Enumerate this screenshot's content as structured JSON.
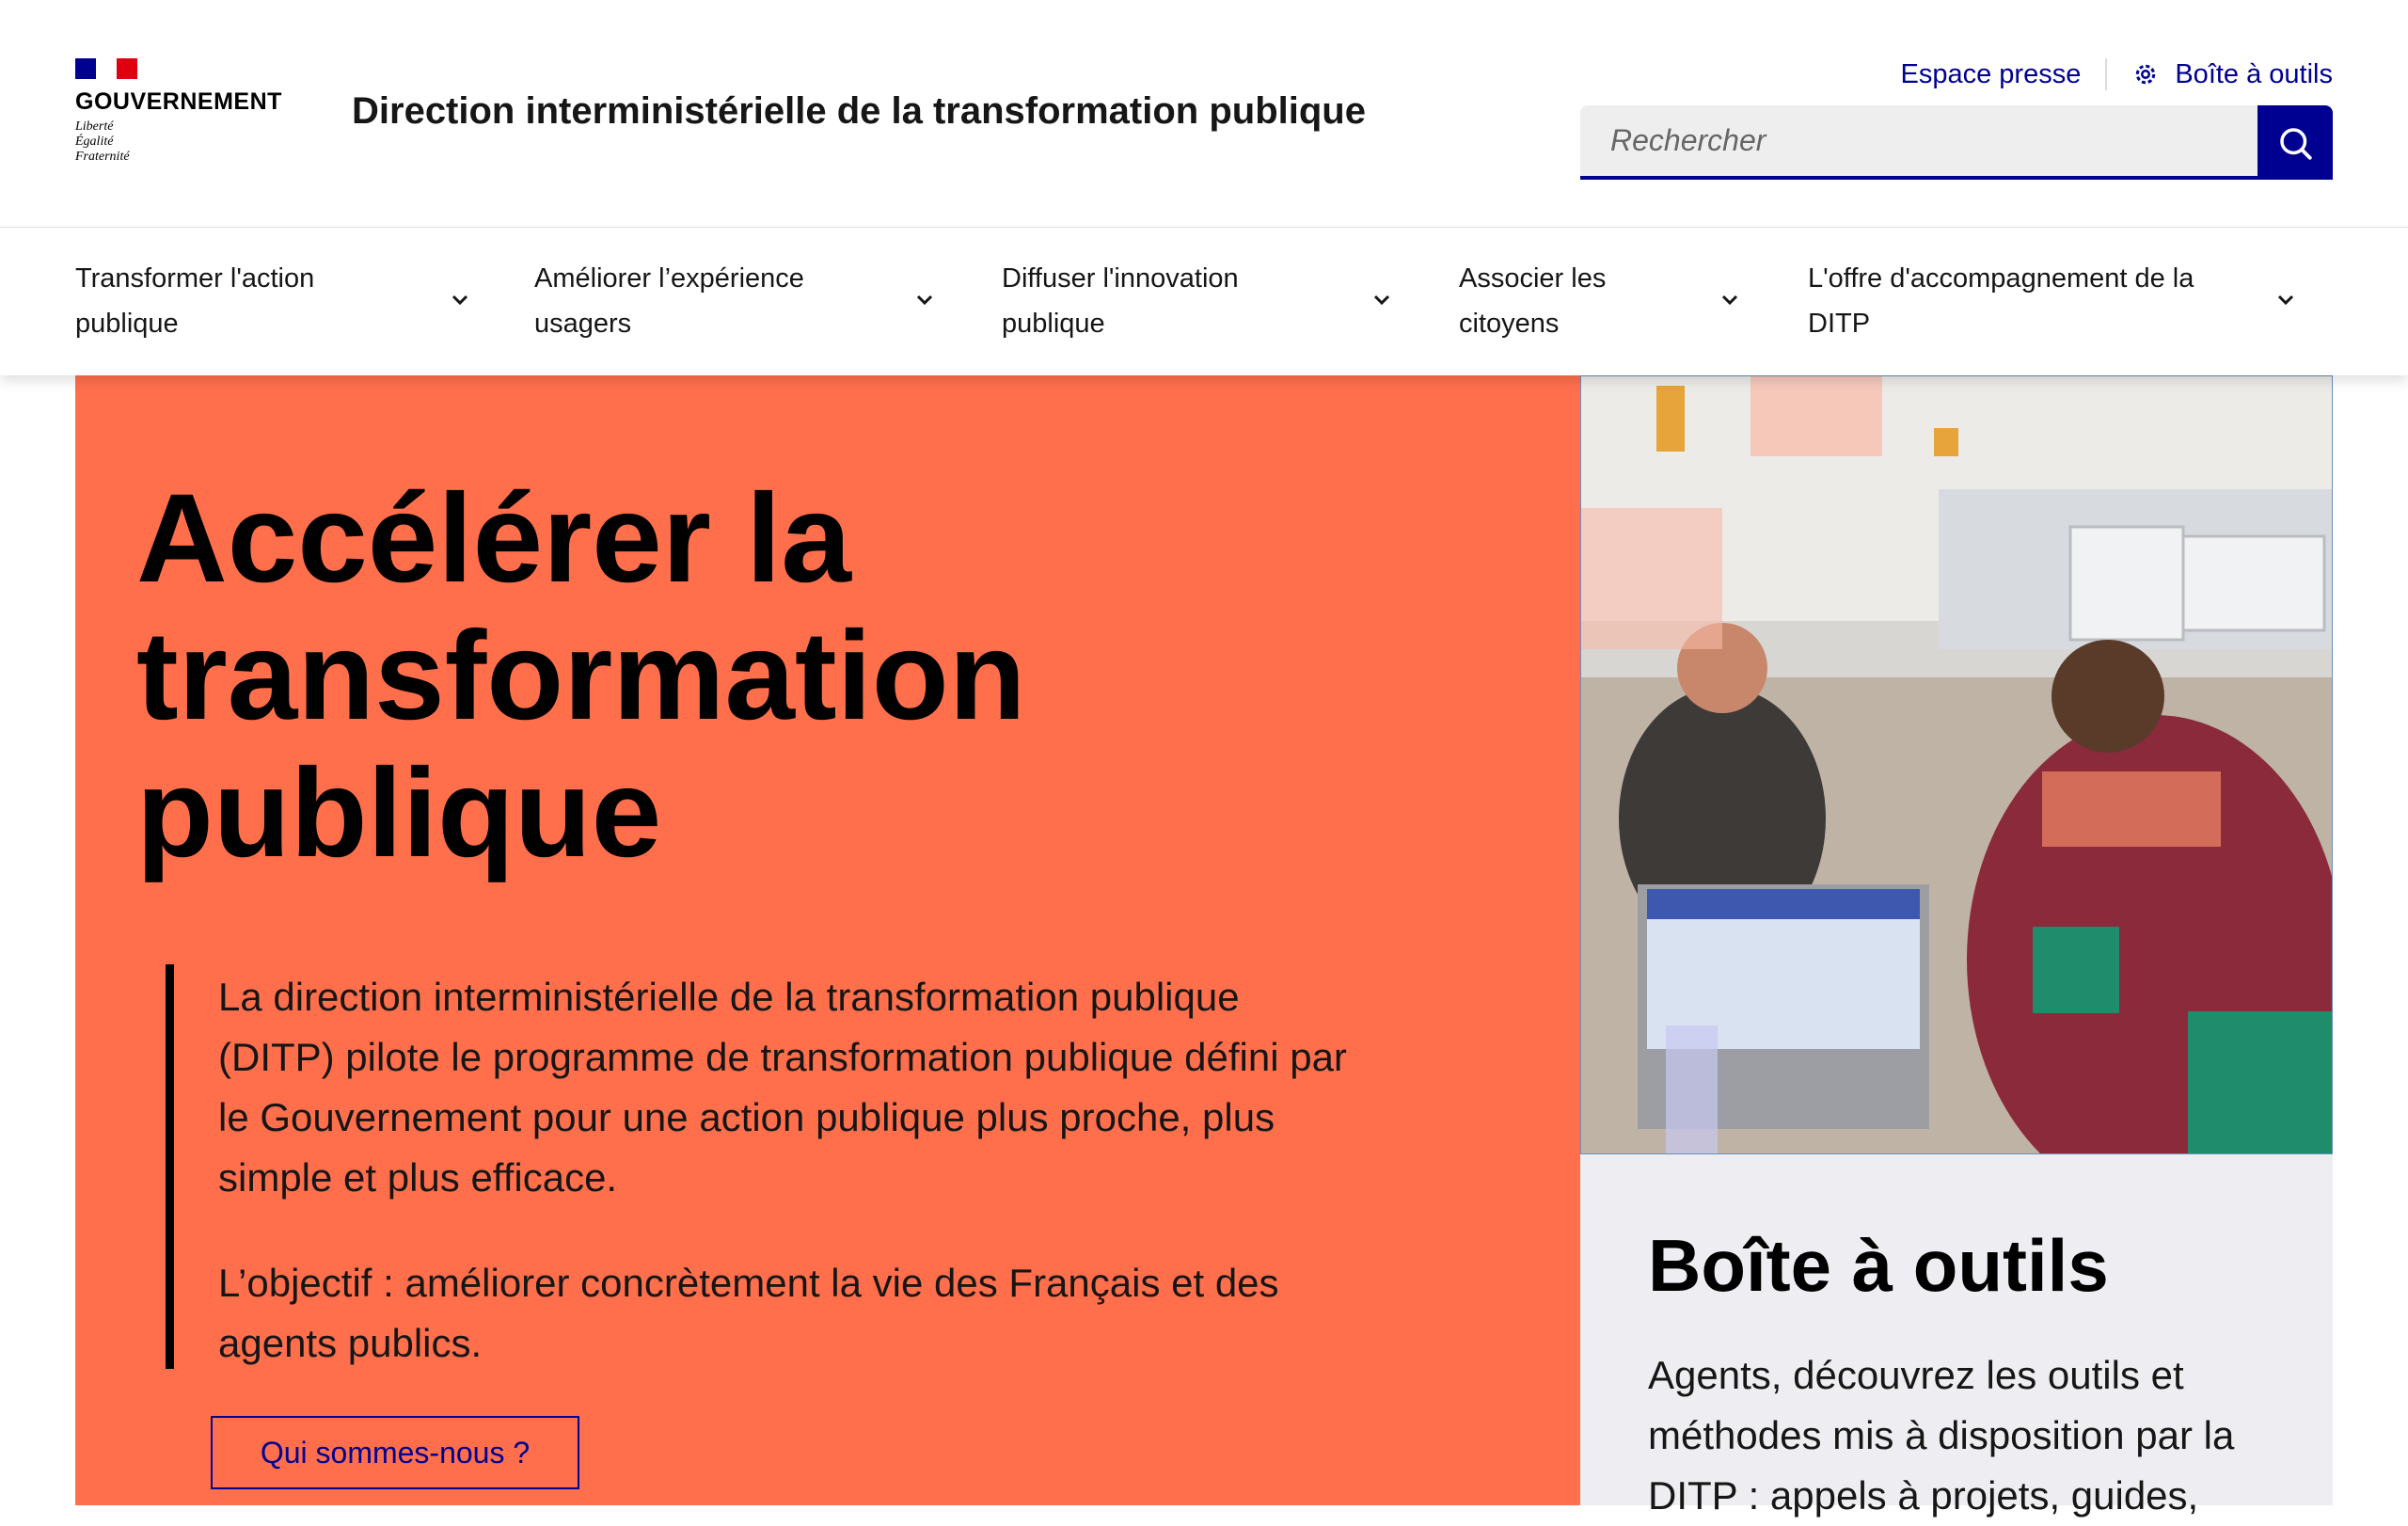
{
  "header": {
    "gov_word": "GOUVERNEMENT",
    "motto": [
      "Liberté",
      "Égalité",
      "Fraternité"
    ],
    "site_title": "Direction interministérielle de la transformation publique",
    "press_link": "Espace presse",
    "toolbox_link": "Boîte à outils",
    "search_placeholder": "Rechercher"
  },
  "nav": {
    "items": [
      {
        "line1": "Transformer l'action",
        "line2": "publique"
      },
      {
        "line1": "Améliorer l’expérience",
        "line2": "usagers"
      },
      {
        "line1": "Diffuser l'innovation",
        "line2": "publique"
      },
      {
        "line1": "Associer les",
        "line2": "citoyens"
      },
      {
        "line1": "L'offre d'accompagnement de la",
        "line2": "DITP"
      }
    ]
  },
  "hero": {
    "title_lines": [
      "Accélérer la",
      "transformation",
      "publique"
    ],
    "paragraph1": "La direction interministérielle de la transformation publique (DITP) pilote le programme de transformation publique défini par le Gouvernement pour une action publique plus proche, plus simple et plus efficace.",
    "paragraph2": "L’objectif : améliorer concrètement la vie des Français et des agents publics.",
    "button": "Qui sommes-nous ?"
  },
  "card": {
    "title": "Boîte à outils",
    "text": "Agents, découvrez les outils et méthodes mis à disposition par la DITP : appels à projets, guides,"
  },
  "colors": {
    "primary_blue": "#000091",
    "hero_orange": "#ff6f4c",
    "card_grey": "#eeeef2",
    "accent_green": "#1f8d6b"
  }
}
